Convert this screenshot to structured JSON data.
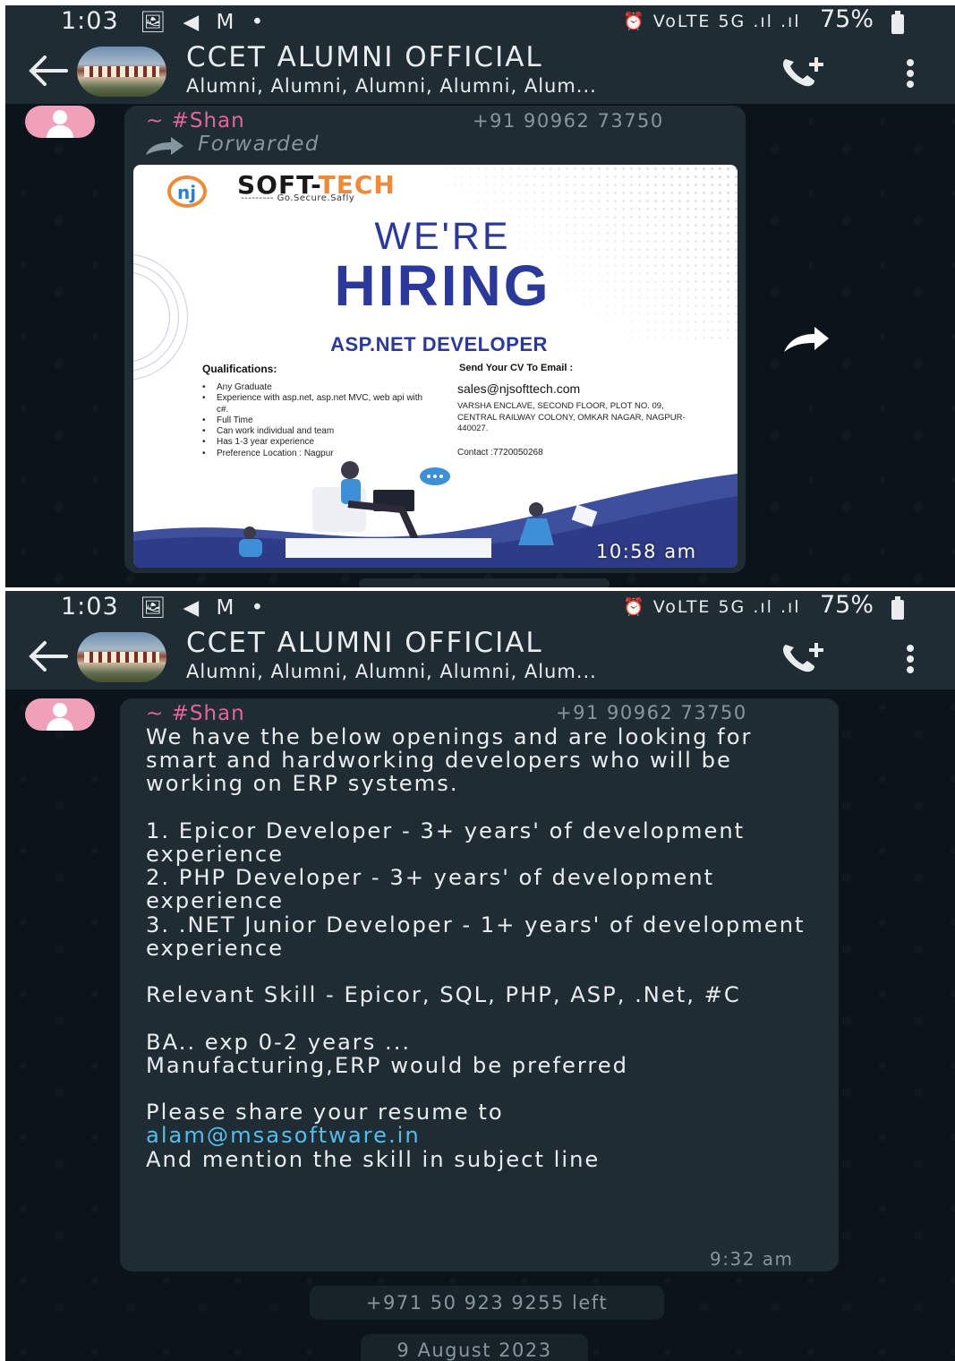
{
  "status_bar": {
    "time": "1:03",
    "left_icons": "🖼 ◀ M •",
    "right_icons": "⏰ VoLTE 5G .ıl .ıl",
    "battery": "75%"
  },
  "header": {
    "title": "CCET ALUMNI OFFICIAL",
    "subtitle": "Alumni, Alumni, Alumni, Alumni, Alum..."
  },
  "image_message": {
    "sender": "~ #Shan",
    "phone": "+91 90962 73750",
    "forwarded_label": "Forwarded",
    "time": "10:58 am",
    "poster": {
      "brand_prefix": "SOFT-",
      "brand_suffix": "TECH",
      "tagline": "--------- Go.Secure.Safly",
      "headline_1": "WE'RE",
      "headline_2": "HIRING",
      "role": "ASP.NET DEVELOPER",
      "qualifications_heading": "Qualifications:",
      "qualifications": [
        "Any Graduate",
        "Experience with asp.net, asp.net MVC, web api with c#.",
        "Full Time",
        "Can work individual and team",
        "Has 1-3 year experience",
        "Preference Location : Nagpur"
      ],
      "email_heading": "Send Your CV To Email :",
      "email": "sales@njsofttech.com",
      "address": "Varsha Enclave, Second Floor, Plot No. 09, Central Railway Colony, Omkar Nagar, Nagpur-440027.",
      "contact": "Contact :7720050268"
    }
  },
  "text_message": {
    "sender": "~ #Shan",
    "phone": "+91 90962 73750",
    "body_main": "We have the below openings and are looking for smart and hardworking developers who will be working on ERP systems.\n\n1. Epicor Developer - 3+ years' of development experience\n2. PHP Developer - 3+ years' of development experience\n3. .NET Junior Developer - 1+ years' of development experience\n\nRelevant Skill - Epicor, SQL, PHP, ASP, .Net, #C\n\nBA.. exp 0-2 years ...\nManufacturing,ERP would be preferred\n\nPlease share your resume to\n",
    "email_link": "alam@msasoftware.in",
    "body_tail": "\nAnd mention the skill in subject line",
    "time": "9:32 am"
  },
  "system_notice": "+971 50 923 9255 left",
  "date_chip": "9 August 2023",
  "colors": {
    "chat_background": "#0b141a",
    "header_background": "#1f2c34",
    "bubble": "#202c33",
    "sender_pink": "#e5649c",
    "link_blue": "#53bdeb",
    "poster_blue": "#2b3a9a",
    "poster_orange": "#f08a3a"
  },
  "icons": [
    "back-arrow-icon",
    "group-avatar",
    "add-call-icon",
    "more-vert-icon",
    "default-avatar-icon",
    "forward-icon",
    "share-icon"
  ]
}
